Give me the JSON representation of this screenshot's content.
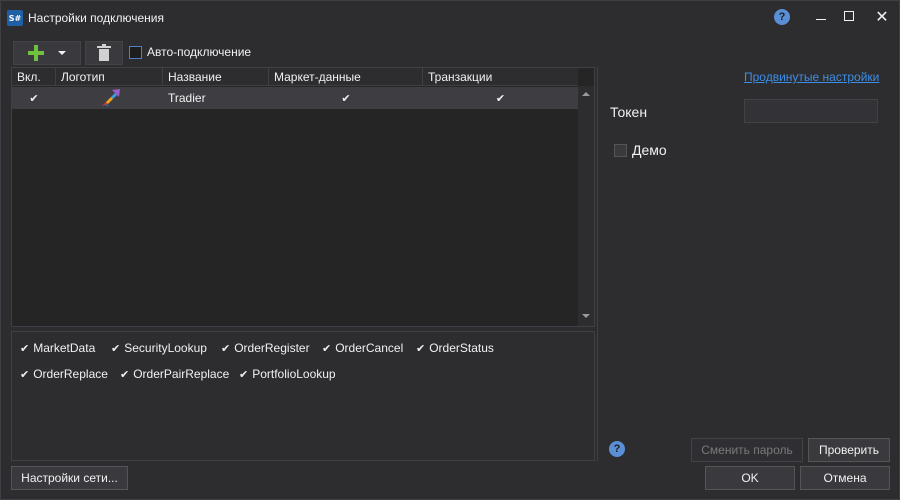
{
  "window": {
    "app_icon": "S#",
    "title": "Настройки подключения",
    "help_glyph": "?"
  },
  "toolbar": {
    "auto_connect_label": "Авто-подключение"
  },
  "grid": {
    "columns": [
      "Вкл.",
      "Логотип",
      "Название",
      "Маркет-данные",
      "Транзакции"
    ],
    "rows": [
      {
        "enabled": true,
        "name": "Tradier",
        "market_data": true,
        "transactions": true
      }
    ]
  },
  "features": [
    "MarketData",
    "SecurityLookup",
    "OrderRegister",
    "OrderCancel",
    "OrderStatus",
    "OrderReplace",
    "OrderPairReplace",
    "PortfolioLookup"
  ],
  "right_panel": {
    "advanced_link": "Продвинутые настройки",
    "token_label": "Токен",
    "token_value": "",
    "demo_label": "Демо",
    "help_glyph": "?"
  },
  "buttons": {
    "change_password": "Сменить пароль",
    "check": "Проверить",
    "network_settings": "Настройки сети...",
    "ok": "OK",
    "cancel": "Отмена"
  },
  "glyphs": {
    "check": "✔",
    "close": "✕"
  }
}
